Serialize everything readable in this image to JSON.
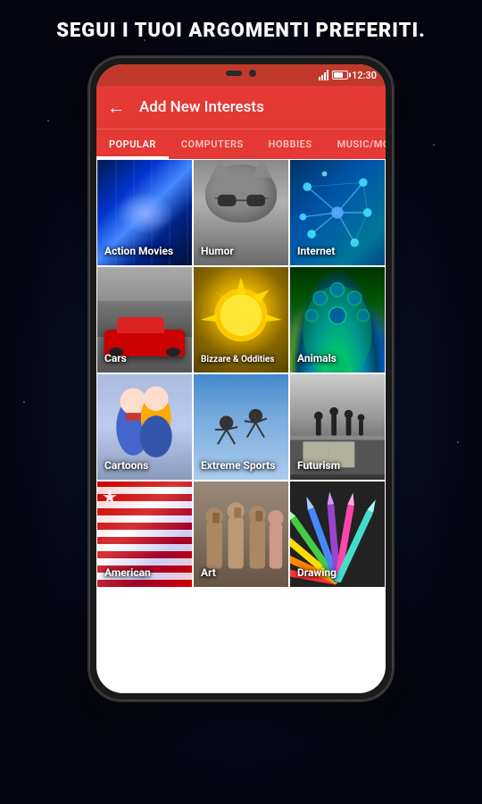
{
  "headline": "SEGUI I TUOI ARGOMENTI PREFERITI.",
  "status": {
    "time": "12:30"
  },
  "appbar": {
    "title": "Add New Interests",
    "back_label": "←"
  },
  "tabs": [
    {
      "id": "popular",
      "label": "POPULAR",
      "active": true
    },
    {
      "id": "computers",
      "label": "COMPUTERS",
      "active": false
    },
    {
      "id": "hobbies",
      "label": "HOBBIES",
      "active": false
    },
    {
      "id": "music",
      "label": "MUSIC/MO",
      "active": false
    }
  ],
  "grid": [
    {
      "id": "action-movies",
      "label": "Action Movies",
      "bg": "action"
    },
    {
      "id": "humor",
      "label": "Humor",
      "bg": "humor"
    },
    {
      "id": "internet",
      "label": "Internet",
      "bg": "internet"
    },
    {
      "id": "cars",
      "label": "Cars",
      "bg": "cars"
    },
    {
      "id": "bizarre",
      "label": "Bizzare & Oddities",
      "bg": "bizarre"
    },
    {
      "id": "animals",
      "label": "Animals",
      "bg": "animals"
    },
    {
      "id": "cartoons",
      "label": "Cartoons",
      "bg": "cartoons"
    },
    {
      "id": "extreme-sports",
      "label": "Extreme Sports",
      "bg": "extreme"
    },
    {
      "id": "futurism",
      "label": "Futurism",
      "bg": "futurism"
    },
    {
      "id": "american",
      "label": "American",
      "bg": "american"
    },
    {
      "id": "art",
      "label": "Art",
      "bg": "art"
    },
    {
      "id": "drawing",
      "label": "Drawing",
      "bg": "drawing"
    }
  ]
}
